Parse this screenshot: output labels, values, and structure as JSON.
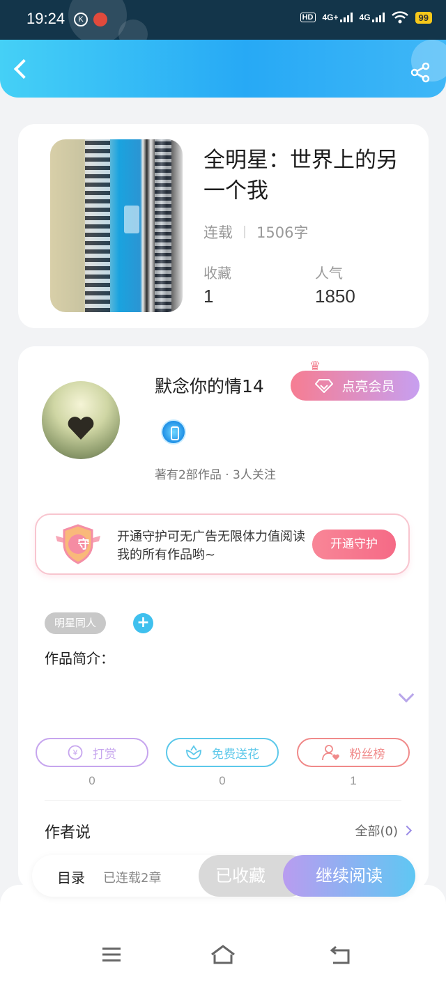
{
  "status_bar": {
    "time": "19:24",
    "icons": [
      "k-circle-icon",
      "weibo-icon",
      "hd-icon",
      "4g-plus-signal-icon",
      "4g-signal-icon",
      "wifi-icon"
    ],
    "hd_label": "HD",
    "signal1_label": "4G+",
    "signal2_label": "4G",
    "battery": "99"
  },
  "header": {
    "back_icon": "chevron-left-icon",
    "share_icon": "share-icon"
  },
  "book": {
    "title": "全明星：世界上的另一个我",
    "status": "连载",
    "word_count": "1506字",
    "favorites_label": "收藏",
    "favorites_value": "1",
    "popularity_label": "人气",
    "popularity_value": "1850"
  },
  "author": {
    "name": "默念你的情14",
    "vip_button": "点亮会员",
    "meta": "著有2部作品 · 3人关注"
  },
  "guard": {
    "icon_char": "守",
    "text": "开通守护可无广告无限体力值阅读我的所有作品哟~",
    "button": "开通守护"
  },
  "tags": [
    "明星同人"
  ],
  "intro_label": "作品简介：",
  "actions": [
    {
      "label": "打赏",
      "count": "0",
      "icon": "yen-coin-icon",
      "color": "#c6a5ee"
    },
    {
      "label": "免费送花",
      "count": "0",
      "icon": "flower-icon",
      "color": "#5cc8ea"
    },
    {
      "label": "粉丝榜",
      "count": "1",
      "icon": "fan-user-heart-icon",
      "color": "#f08a8a"
    }
  ],
  "author_says": {
    "label": "作者说",
    "all": "全部(0)"
  },
  "bottom_bar": {
    "toc": "目录",
    "chapters": "已连载2章",
    "collected": "已收藏",
    "continue_reading": "继续阅读"
  },
  "nav": [
    "menu-icon",
    "home-icon",
    "back-icon"
  ]
}
